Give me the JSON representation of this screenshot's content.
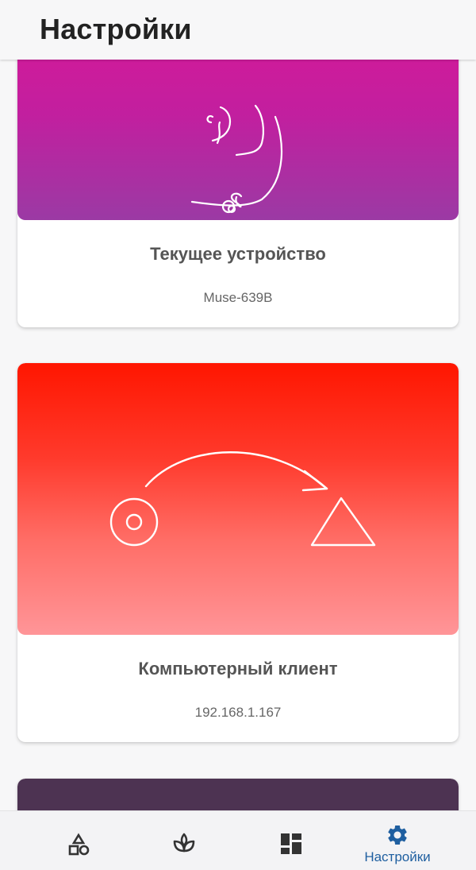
{
  "header": {
    "title": "Настройки"
  },
  "cards": [
    {
      "title": "Текущее устройство",
      "subtitle": "Muse-639B"
    },
    {
      "title": "Компьютерный клиент",
      "subtitle": "192.168.1.167"
    }
  ],
  "bottom_nav": {
    "items": [
      {
        "icon": "shapes-icon",
        "label": ""
      },
      {
        "icon": "sprout-icon",
        "label": ""
      },
      {
        "icon": "dashboard-icon",
        "label": ""
      },
      {
        "icon": "gear-icon",
        "label": "Настройки",
        "active": true
      }
    ]
  },
  "colors": {
    "accent": "#1f5fa0",
    "card1_gradient": [
      "#d41a98",
      "#9b3aa4"
    ],
    "card2_gradient": [
      "#ff1600",
      "#ff9598"
    ],
    "card3": "#4d3352"
  }
}
